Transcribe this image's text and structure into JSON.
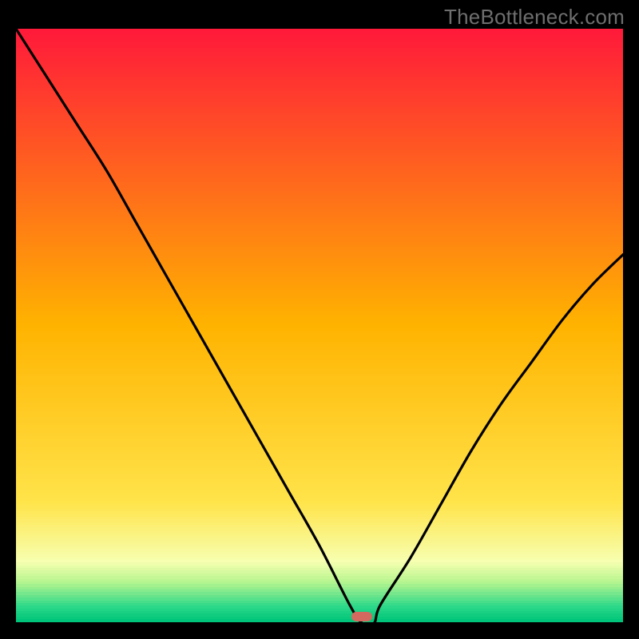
{
  "watermark": "TheBottleneck.com",
  "colors": {
    "black": "#000000",
    "gray": "#6e6e6e",
    "marker": "#d46a5f",
    "gradient_top": "#ff1a3a",
    "gradient_mid": "#ffd500",
    "gradient_low": "#f7ffb0",
    "gradient_band1": "#b6f58f",
    "gradient_band2": "#74e78c",
    "gradient_band3": "#2fd989",
    "gradient_bottom": "#00c57a"
  },
  "chart_data": {
    "type": "line",
    "title": "",
    "xlabel": "",
    "ylabel": "",
    "xlim": [
      0,
      100
    ],
    "ylim": [
      0,
      100
    ],
    "note": "Axes are unlabeled; x is a normalized horizontal position (0 at left, 100 at right of the colored area) and y is bottleneck % (0 at bottom/green, 100 at top/red). Values estimated from the plotted curve.",
    "optimal_x": 57,
    "series": [
      {
        "name": "bottleneck-curve",
        "x": [
          0,
          5,
          10,
          15,
          20,
          25,
          30,
          35,
          40,
          45,
          50,
          55,
          57,
          59,
          60,
          65,
          70,
          75,
          80,
          85,
          90,
          95,
          100
        ],
        "y": [
          100,
          92,
          84,
          76,
          67,
          58,
          49,
          40,
          31,
          22,
          13,
          3,
          0,
          0,
          3,
          11,
          20,
          29,
          37,
          44,
          51,
          57,
          62
        ]
      }
    ],
    "marker": {
      "x": 57,
      "y": 0,
      "width_pct": 3.5
    },
    "background_gradient_stops": [
      {
        "pos": 0.0,
        "color": "#ff1a3a"
      },
      {
        "pos": 0.5,
        "color": "#ffb300"
      },
      {
        "pos": 0.8,
        "color": "#ffe44a"
      },
      {
        "pos": 0.9,
        "color": "#f7ffb0"
      },
      {
        "pos": 0.935,
        "color": "#b6f58f"
      },
      {
        "pos": 0.955,
        "color": "#74e78c"
      },
      {
        "pos": 0.975,
        "color": "#2fd989"
      },
      {
        "pos": 1.0,
        "color": "#00c57a"
      }
    ]
  }
}
